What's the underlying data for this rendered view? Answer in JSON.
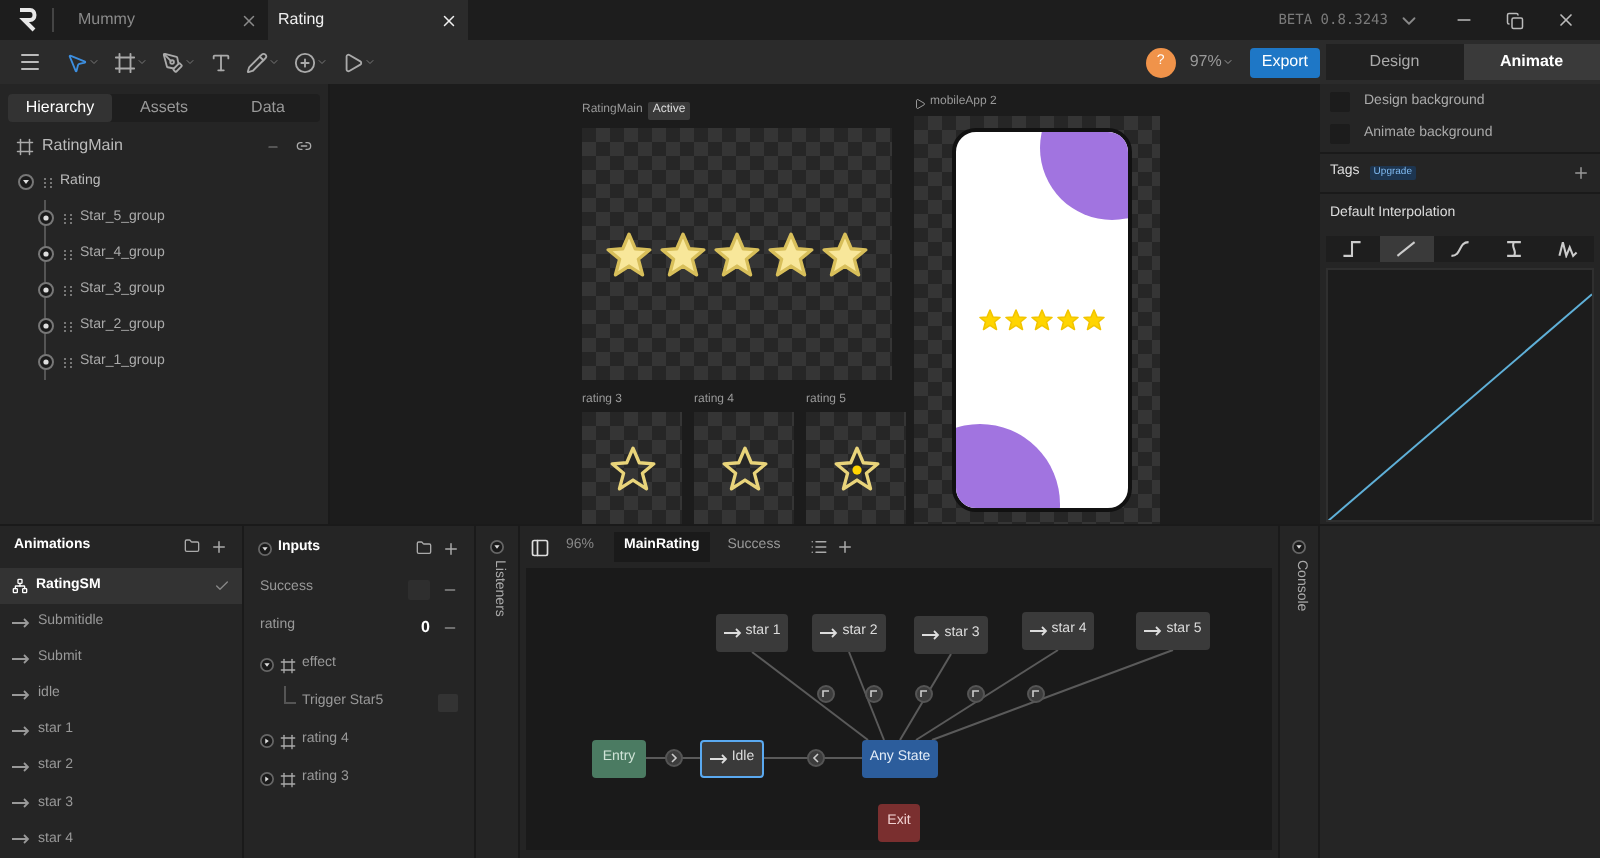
{
  "title_bar": {
    "tabs": [
      {
        "label": "Mummy",
        "selected": false
      },
      {
        "label": "Rating",
        "selected": true
      }
    ],
    "version": "BETA 0.8.3243"
  },
  "toolbar": {
    "avatar": "?",
    "zoom": "97%",
    "export": "Export",
    "modes": [
      {
        "label": "Design",
        "selected": false
      },
      {
        "label": "Animate",
        "selected": true
      }
    ]
  },
  "hierarchy": {
    "tabs": [
      {
        "label": "Hierarchy",
        "selected": true
      },
      {
        "label": "Assets",
        "selected": false
      },
      {
        "label": "Data",
        "selected": false
      }
    ],
    "artboard": "RatingMain",
    "tree": [
      {
        "label": "Rating",
        "expanded": true,
        "children": [
          {
            "label": "Star_5_group"
          },
          {
            "label": "Star_4_group"
          },
          {
            "label": "Star_3_group"
          },
          {
            "label": "Star_2_group"
          },
          {
            "label": "Star_1_group"
          }
        ]
      }
    ]
  },
  "canvas": {
    "main_artboard": {
      "name": "RatingMain",
      "badge": "Active",
      "stars": 5
    },
    "rating_artboards": [
      {
        "name": "rating 3",
        "kind": "outline"
      },
      {
        "name": "rating 4",
        "kind": "outline"
      },
      {
        "name": "rating 5",
        "kind": "dotted"
      }
    ],
    "phone_artboard": {
      "name": "mobileApp 2",
      "stars": 5
    }
  },
  "inspector": {
    "backgrounds": [
      {
        "label": "Design background",
        "checked": false
      },
      {
        "label": "Animate background",
        "checked": false
      }
    ],
    "tags": {
      "label": "Tags",
      "badge": "Upgrade"
    },
    "interpolation": {
      "title": "Default Interpolation",
      "options": [
        {
          "kind": "hold",
          "selected": false
        },
        {
          "kind": "linear",
          "selected": true
        },
        {
          "kind": "cubic",
          "selected": false
        },
        {
          "kind": "elastic",
          "selected": false
        },
        {
          "kind": "spring",
          "selected": false
        }
      ]
    }
  },
  "animations": {
    "title": "Animations",
    "items": [
      {
        "label": "RatingSM",
        "kind": "state_machine",
        "selected": true
      },
      {
        "label": "Submitidle",
        "kind": "timeline",
        "selected": false
      },
      {
        "label": "Submit",
        "kind": "timeline",
        "selected": false
      },
      {
        "label": "idle",
        "kind": "timeline",
        "selected": false
      },
      {
        "label": "star 1",
        "kind": "timeline",
        "selected": false
      },
      {
        "label": "star 2",
        "kind": "timeline",
        "selected": false
      },
      {
        "label": "star 3",
        "kind": "timeline",
        "selected": false
      },
      {
        "label": "star 4",
        "kind": "timeline",
        "selected": false
      }
    ]
  },
  "inputs": {
    "title": "Inputs",
    "items": [
      {
        "label": "Success",
        "kind": "boolean"
      },
      {
        "label": "rating",
        "kind": "number",
        "value": "0"
      }
    ],
    "layers": [
      {
        "label": "effect",
        "expanded": true,
        "children": [
          {
            "label": "Trigger Star5"
          }
        ]
      },
      {
        "label": "rating 4",
        "expanded": false
      },
      {
        "label": "rating 3",
        "expanded": false
      }
    ]
  },
  "listeners": {
    "label": "Listeners"
  },
  "console": {
    "label": "Console"
  },
  "graph": {
    "zoom": "96%",
    "tabs": [
      {
        "label": "MainRating",
        "selected": true
      },
      {
        "label": "Success",
        "selected": false
      }
    ],
    "nodes": [
      {
        "label": "star 1",
        "kind": "state",
        "selected": false
      },
      {
        "label": "star 2",
        "kind": "state",
        "selected": false
      },
      {
        "label": "star 3",
        "kind": "state",
        "selected": false
      },
      {
        "label": "star 4",
        "kind": "state",
        "selected": false
      },
      {
        "label": "star 5",
        "kind": "state",
        "selected": false
      },
      {
        "label": "Entry",
        "kind": "entry",
        "selected": false
      },
      {
        "label": "Idle",
        "kind": "state",
        "selected": true
      },
      {
        "label": "Any State",
        "kind": "any",
        "selected": false
      },
      {
        "label": "Exit",
        "kind": "exit",
        "selected": false
      }
    ]
  }
}
